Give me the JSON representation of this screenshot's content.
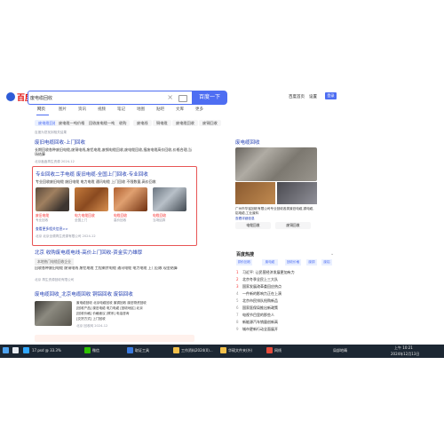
{
  "logo": {
    "text": "百度"
  },
  "search": {
    "value": "废电缆回收",
    "button": "百度一下"
  },
  "top_links": {
    "left": "百度首页",
    "settings": "设置",
    "login": "登录"
  },
  "tabs": [
    "网页",
    "图片",
    "资讯",
    "视频",
    "笔记",
    "地图",
    "贴吧",
    "文库",
    "更多"
  ],
  "filters": [
    "废电缆回收",
    "废电缆一吨价格",
    "回收废电缆一吨",
    "收购",
    "废电线",
    "铜电缆",
    "废电缆回收",
    "废铜回收"
  ],
  "tools_hint": "百度为您找到相关结果",
  "result1": {
    "title": "废旧电缆回收-上门回收",
    "text": "长期回收各种废旧电缆,废铜电线,废铝电缆,废钢电缆回收,废电缆回收,报废电缆高价回收,价格合理,当场结算",
    "meta": "北京鑫鑫再生资源 2024-12"
  },
  "result2": {
    "title": "专业回收二手电缆 废旧电缆-全国上门回收-专业回收",
    "text": "专业回收废旧电缆 废旧电缆 电力电缆 通讯电缆 上门回收 不限数量,高价回收",
    "thumbs": [
      {
        "label": "废旧电缆",
        "sub": "专业回收"
      },
      {
        "label": "电力电缆回收",
        "sub": "全国上门"
      },
      {
        "label": "电缆回收",
        "sub": "高价回收"
      },
      {
        "label": "电缆回收",
        "sub": "当场结算"
      }
    ],
    "more": "查看更多相关信息>>",
    "meta": "北京 北京全顺再生资源有限公司 2024-12"
  },
  "result3": {
    "title": "北京 收购废电缆电线-高价上门回收-资金实力雄厚",
    "badge": "本地热门电缆回收企业",
    "text": "回收各种废旧电缆 废铜电线 废铝电缆 工程剩余电缆 通讯电缆 电力电缆 上门回收 现金结算",
    "meta": "北京 再生资源回收有限公司"
  },
  "result4": {
    "title": "废电缆回收_北京电缆回收 铜铝回收 废铝回收",
    "lines": [
      "废电缆回收 北京电缆回收 废铜回收 废旧物资回收",
      "[回收产品] 废旧电缆 电力电缆 [回收地区] 北京",
      "[回收价格] 价格面议 [联系] 电话咨询",
      "[交货方式] 上门回收"
    ],
    "meta": "北京 回收网 2024-12"
  },
  "knowledge": {
    "title": "废电缆回收",
    "text": "广州市华铭回收有限公司专业回收各类废旧电缆,铜电缆,铝电缆,工业废料",
    "link": "查看详细信息",
    "actions": [
      "电缆回收",
      "废铜回收"
    ]
  },
  "hot": {
    "title": "百度热搜",
    "tags": [
      "铜价回收",
      "废电缆",
      "回收价格",
      "废铜",
      "废铝"
    ],
    "items": [
      {
        "n": "1",
        "t": "习近平: 让民营经济发展更加有力"
      },
      {
        "n": "2",
        "t": "北京冬季全民上三大队"
      },
      {
        "n": "3",
        "t": "国家发展改革委回应热点"
      },
      {
        "n": "4",
        "t": "一件新的影响力正在上演"
      },
      {
        "n": "5",
        "t": "北京市民排队抢购新品"
      },
      {
        "n": "6",
        "t": "国家医保局推出新政策"
      },
      {
        "n": "7",
        "t": "电视节目里的那些人"
      },
      {
        "n": "8",
        "t": "新能源汽车销量创新高"
      },
      {
        "n": "9",
        "t": "城市更新行动全面展开"
      }
    ]
  },
  "taskbar": {
    "items": [
      "17.psd @ 33.3%",
      "微信",
      "取证工具",
      "工作资料2024(0)...",
      "华硕文件夹(外)",
      "网线"
    ],
    "weather": "局部地晴",
    "time": "上午 10:21",
    "date": "2024年12月13日"
  },
  "colors": {
    "accent": "#4e6ef2",
    "link": "#2440b3",
    "red": "#f73131"
  }
}
